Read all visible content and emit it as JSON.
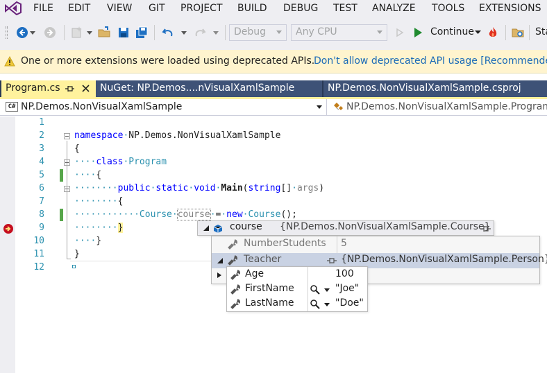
{
  "menu": {
    "items": [
      "FILE",
      "EDIT",
      "VIEW",
      "GIT",
      "PROJECT",
      "BUILD",
      "DEBUG",
      "TEST",
      "ANALYZE",
      "TOOLS",
      "EXTENSIONS"
    ]
  },
  "toolbar": {
    "config_value": "Debug",
    "platform_value": "Any CPU",
    "continue_label": "Continue",
    "truncated_label": "Sta"
  },
  "infobar": {
    "message": "One or more extensions were loaded using deprecated APIs.",
    "link": "Don't allow deprecated API usage [Recommended"
  },
  "tabs": {
    "program": "Program.cs",
    "nuget": "NuGet: NP.Demos....nVisualXamlSample",
    "csproj": "NP.Demos.NonVisualXamlSample.csproj"
  },
  "navbar": {
    "project_badge": "C#",
    "project": "NP.Demos.NonVisualXamlSample",
    "member": "NP.Demos.NonVisualXamlSample.Program"
  },
  "editor": {
    "line_numbers": [
      "1",
      "2",
      "3",
      "4",
      "5",
      "6",
      "7",
      "8",
      "9",
      "10",
      "11",
      "12"
    ],
    "kw_namespace": "namespace",
    "ns_name": "NP.Demos.NonVisualXamlSample",
    "brace_open": "{",
    "brace_close": "}",
    "kw_class": "class",
    "class_name": "Program",
    "kw_public": "public",
    "kw_static": "static",
    "kw_void": "void",
    "method_name": "Main",
    "kw_string": "string",
    "brackets": "[]",
    "param_name": "args",
    "paren_close": ")",
    "paren_open": "(",
    "type_course": "Course",
    "var_course": "course",
    "equals": "=",
    "kw_new": "new",
    "ctor_tail": "();"
  },
  "datatip": {
    "root_name": "course",
    "root_value": "{NP.Demos.NonVisualXamlSample.Course}",
    "numberstudents_name": "NumberStudents",
    "numberstudents_value": "5",
    "teacher_name": "Teacher",
    "teacher_value": "{NP.Demos.NonVisualXamlSample.Person}",
    "age_name": "Age",
    "age_value": "100",
    "firstname_name": "FirstName",
    "firstname_value": "\"Joe\"",
    "lastname_name": "LastName",
    "lastname_value": "\"Doe\""
  },
  "colors": {
    "accent_tab": "#fff29d",
    "tab_bar": "#293955",
    "info_bg": "#fff4ce",
    "keyword": "#0000ff",
    "type": "#2b91af",
    "link": "#1a6ab7",
    "changed_line": "#57a64a",
    "breakpoint": "#c50e1f"
  }
}
